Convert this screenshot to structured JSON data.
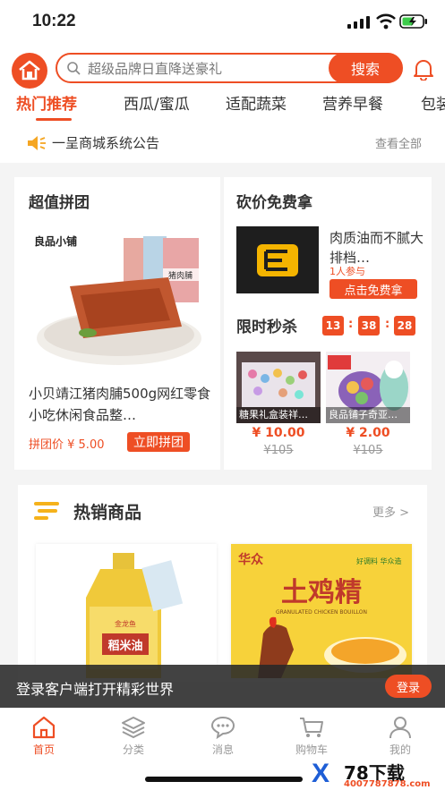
{
  "status": {
    "time": "10:22"
  },
  "search": {
    "placeholder": "超级品牌日直降送豪礼",
    "button": "搜索"
  },
  "tabs": [
    "热门推荐",
    "西瓜/蜜瓜",
    "适配蔬菜",
    "营养早餐",
    "包装"
  ],
  "notice": {
    "text": "一呈商城系统公告",
    "more": "查看全部"
  },
  "group_buy": {
    "title": "超值拼团",
    "product_name": "小贝靖江猪肉脯500g网红零食小吃休闲食品整…",
    "price_label": "拼团价 ¥ 5.00",
    "button": "立即拼团",
    "package_brand": "良品小铺",
    "package_label": "猪肉脯"
  },
  "bargain": {
    "title": "砍价免费拿",
    "product_name": "肉质油而不腻大排档…",
    "joined": "1人参与",
    "button": "点击免费拿"
  },
  "flash_sale": {
    "title": "限时秒杀",
    "countdown": [
      "13",
      "38",
      "28"
    ],
    "items": [
      {
        "caption": "糖果礼盒装祥…",
        "price": "¥ 10.00",
        "original": "¥105"
      },
      {
        "caption": "良品铺子奇亚…",
        "price": "¥ 2.00",
        "original": "¥105"
      }
    ]
  },
  "hot": {
    "title": "热销商品",
    "more": "更多 >",
    "items": [
      {
        "label": "稻米油",
        "brand": "金龙鱼"
      },
      {
        "title": "土鸡精",
        "brand": "华众",
        "subtitle": "GRANULATED CHICKEN BOUILLON",
        "slogan": "好调料 华众造"
      }
    ]
  },
  "login_bar": {
    "text": "登录客户端打开精彩世界",
    "button": "登录"
  },
  "tabbar": [
    "首页",
    "分类",
    "消息",
    "购物车",
    "我的"
  ],
  "watermark": {
    "text": "78下载",
    "url": "4007787878.com"
  },
  "colors": {
    "accent": "#ee4e24"
  }
}
